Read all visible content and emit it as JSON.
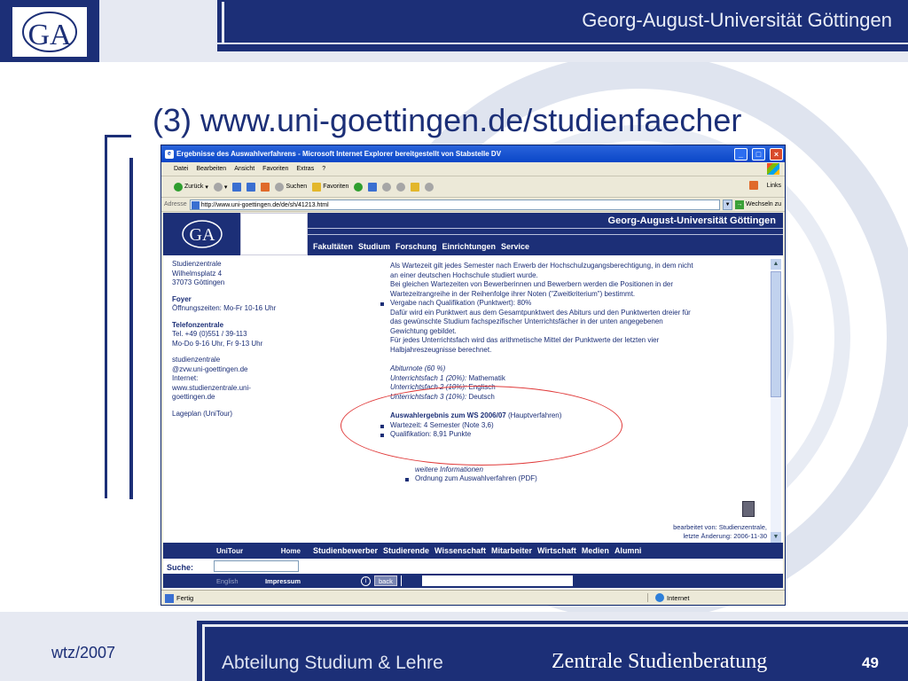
{
  "slide": {
    "header_title": "Georg-August-Universität Göttingen",
    "title": "(3) www.uni-goettingen.de/studienfaecher",
    "footer_left": "wtz/2007",
    "footer_middle": "Abteilung Studium & Lehre",
    "footer_right": "Zentrale Studienberatung",
    "page_number": "49"
  },
  "browser": {
    "title": "Ergebnisse des Auswahlverfahrens - Microsoft Internet Explorer bereitgestellt von Stabstelle DV",
    "menu": [
      "Datei",
      "Bearbeiten",
      "Ansicht",
      "Favoriten",
      "Extras",
      "?"
    ],
    "toolbar": {
      "back": "Zurück",
      "search": "Suchen",
      "favorites": "Favoriten",
      "links": "Links"
    },
    "address_label": "Adresse",
    "address_value": "http://www.uni-goettingen.de/de/sh/41213.html",
    "go_label": "Wechseln zu",
    "status_text": "Fertig",
    "status_zone": "Internet"
  },
  "site": {
    "title": "Georg-August-Universität Göttingen",
    "nav": [
      "Fakultäten",
      "Studium",
      "Forschung",
      "Einrichtungen",
      "Service"
    ],
    "left_column": {
      "address": [
        "Studienzentrale",
        "Wilhelmsplatz 4",
        "37073 Göttingen"
      ],
      "foyer_head": "Foyer",
      "foyer_text": "Öffnungszeiten: Mo-Fr 10-16 Uhr",
      "phone_head": "Telefonzentrale",
      "phone_lines": [
        "Tel. +49 (0)551 / 39-113",
        "Mo-Do 9-16 Uhr, Fr 9-13 Uhr"
      ],
      "contact_lines": [
        "studienzentrale",
        "@zvw.uni-goettingen.de",
        "Internet:",
        "www.studienzentrale.uni-",
        "goettingen.de"
      ],
      "lageplan": "Lageplan (UniTour)"
    },
    "main": {
      "intro_lines": [
        "Als Wartezeit gilt jedes Semester nach Erwerb der Hochschulzugangsberechtigung, in dem nicht",
        "an einer deutschen Hochschule studiert wurde.",
        "Bei gleichen Wartezeiten von Bewerberinnen und Bewerbern werden die Positionen in der",
        "Wartezeitrangreihe in der Reihenfolge ihrer Noten (\"Zweitkriterium\") bestimmt."
      ],
      "bullet_qual": "Vergabe nach Qualifikation (Punktwert): 80%",
      "qual_lines": [
        "Dafür wird ein Punktwert aus dem Gesamtpunktwert des Abiturs und den Punktwerten dreier für",
        "das gewünschte Studium fachspezifischer Unterrichtsfächer in der unten angegebenen",
        "Gewichtung gebildet.",
        "Für jedes Unterrichtsfach wird das arithmetische Mittel der Punktwerte der letzten vier",
        "Halbjahreszeugnisse berechnet."
      ],
      "abinote": "Abiturnote (60 %)",
      "fach1_label": "Unterrichtsfach 1 (20%):",
      "fach1_value": " Mathematik",
      "fach2_label": "Unterrichtsfach 2 (10%):",
      "fach2_value": " Englisch",
      "fach3_label": "Unterrichtsfach 3 (10%):",
      "fach3_value": " Deutsch",
      "result_head": "Auswahlergebnis zum WS 2006/07",
      "result_head_suffix": " (Hauptverfahren)",
      "result_wait": "Wartezeit: 4 Semester (Note 3,6)",
      "result_qual": "Qualifikation: 8,91 Punkte",
      "more_info": "weitere Informationen",
      "order_link": "Ordnung zum Auswahlverfahren (PDF)",
      "edited_by": "bearbeitet von: Studienzentrale,",
      "last_change": "letzte Änderung: 2006-11-30"
    },
    "bottom": {
      "unitour": "UniTour",
      "home": "Home",
      "suche": "Suche:",
      "english": "English",
      "impressum": "Impressum",
      "back": "back",
      "nav": [
        "Studienbewerber",
        "Studierende",
        "Wissenschaft",
        "Mitarbeiter",
        "Wirtschaft",
        "Medien",
        "Alumni"
      ]
    }
  },
  "colors": {
    "brand_blue": "#1c2f77",
    "annotation_red": "#e03a3a"
  }
}
